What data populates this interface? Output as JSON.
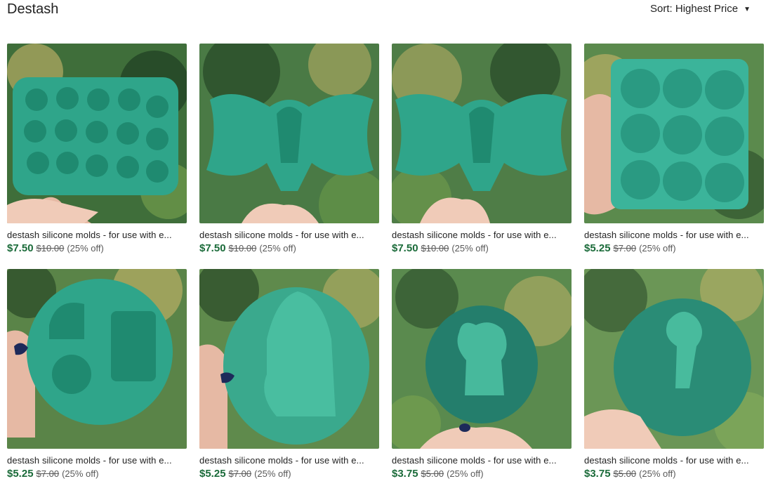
{
  "header": {
    "title": "Destash",
    "sort_label": "Sort: Highest Price"
  },
  "colors": {
    "sale_price": "#1b6b3a",
    "resin": "#2fa58a",
    "background_foliage": "#3f6e3a"
  },
  "listings": [
    {
      "title": "destash silicone molds - for use with e...",
      "price": "$7.50",
      "original_price": "$10.00",
      "discount": "(25% off)",
      "image": "round-flower-tray-mold"
    },
    {
      "title": "destash silicone molds - for use with e...",
      "price": "$7.50",
      "original_price": "$10.00",
      "discount": "(25% off)",
      "image": "moth-triple-moon-mold"
    },
    {
      "title": "destash silicone molds - for use with e...",
      "price": "$7.50",
      "original_price": "$10.00",
      "discount": "(25% off)",
      "image": "moth-triple-moon-mold"
    },
    {
      "title": "destash silicone molds - for use with e...",
      "price": "$5.25",
      "original_price": "$7.00",
      "discount": "(25% off)",
      "image": "circle-tray-mold"
    },
    {
      "title": "destash silicone molds - for use with e...",
      "price": "$5.25",
      "original_price": "$7.00",
      "discount": "(25% off)",
      "image": "round-mixed-shapes-mold"
    },
    {
      "title": "destash silicone molds - for use with e...",
      "price": "$5.25",
      "original_price": "$7.00",
      "discount": "(25% off)",
      "image": "round-ghost-mold"
    },
    {
      "title": "destash silicone molds - for use with e...",
      "price": "$3.75",
      "original_price": "$5.00",
      "discount": "(25% off)",
      "image": "round-cow-character-mold"
    },
    {
      "title": "destash silicone molds - for use with e...",
      "price": "$3.75",
      "original_price": "$5.00",
      "discount": "(25% off)",
      "image": "round-balloon-mold"
    }
  ]
}
